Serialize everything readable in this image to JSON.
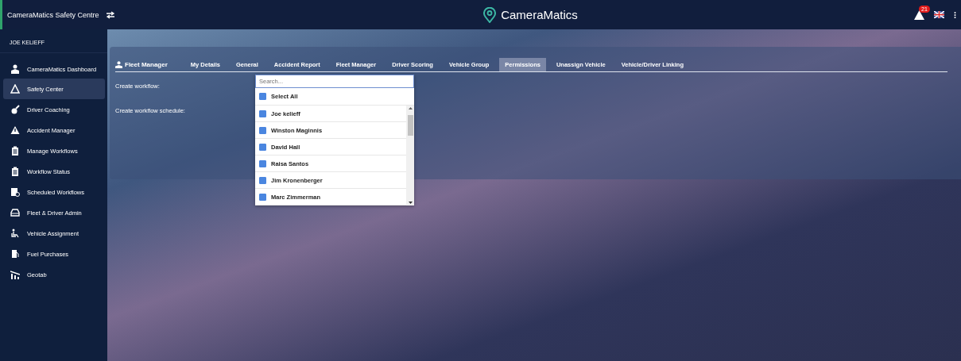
{
  "topbar": {
    "app_title": "CameraMatics Safety Centre",
    "logo_text": "CameraMatics",
    "alert_count": "21"
  },
  "sidebar": {
    "user": "JOE KELIEFF",
    "items": [
      {
        "label": "CameraMatics Dashboard",
        "selected": false
      },
      {
        "label": "Safety Center",
        "selected": true
      },
      {
        "label": "Driver Coaching",
        "selected": false
      },
      {
        "label": "Accident Manager",
        "selected": false
      },
      {
        "label": "Manage Workflows",
        "selected": false
      },
      {
        "label": "Workflow Status",
        "selected": false
      },
      {
        "label": "Scheduled Workflows",
        "selected": false
      },
      {
        "label": "Fleet & Driver Admin",
        "selected": false
      },
      {
        "label": "Vehicle Assignment",
        "selected": false
      },
      {
        "label": "Fuel Purchases",
        "selected": false
      },
      {
        "label": "Geotab",
        "selected": false
      }
    ]
  },
  "panel": {
    "heading": "Fleet Manager",
    "tabs": [
      {
        "label": "My Details",
        "selected": false
      },
      {
        "label": "General",
        "selected": false
      },
      {
        "label": "Accident Report",
        "selected": false
      },
      {
        "label": "Fleet Manager",
        "selected": false
      },
      {
        "label": "Driver Scoring",
        "selected": false
      },
      {
        "label": "Vehicle Group",
        "selected": false
      },
      {
        "label": "Permissions",
        "selected": true
      },
      {
        "label": "Unassign Vehicle",
        "selected": false
      },
      {
        "label": "Vehicle/Driver Linking",
        "selected": false
      }
    ],
    "fields": [
      "Create workflow:",
      "Create workflow schedule:"
    ],
    "dropdown": {
      "placeholder": "Search...",
      "select_all": {
        "label": "Select All",
        "checked": true
      },
      "options": [
        {
          "label": "Joe kelieff",
          "checked": true
        },
        {
          "label": "Winston Maginnis",
          "checked": true
        },
        {
          "label": "David Hall",
          "checked": true
        },
        {
          "label": "Raisa Santos",
          "checked": true
        },
        {
          "label": "Jim Kronenberger",
          "checked": true
        },
        {
          "label": "Marc Zimmerman",
          "checked": true
        }
      ]
    }
  }
}
